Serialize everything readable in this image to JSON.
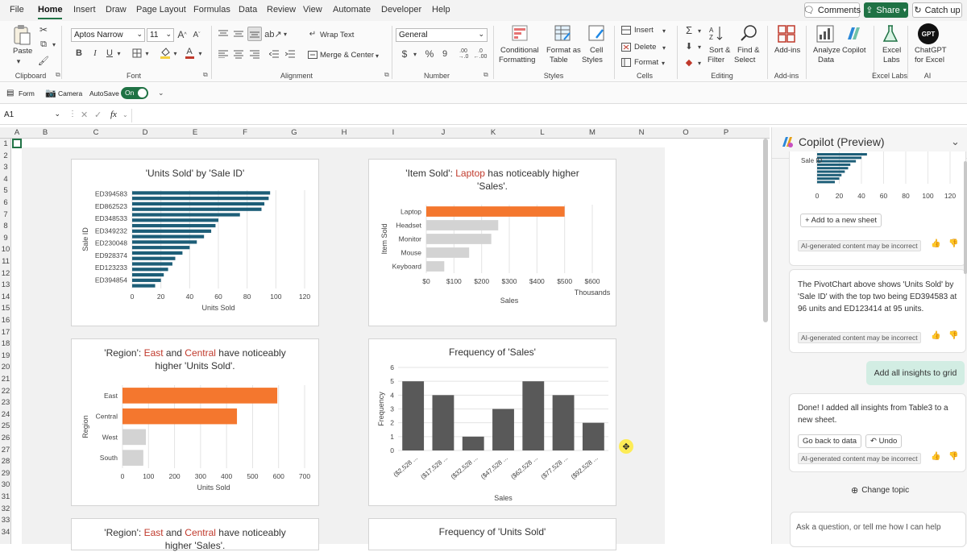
{
  "menu": {
    "items": [
      "File",
      "Home",
      "Insert",
      "Draw",
      "Page Layout",
      "Formulas",
      "Data",
      "Review",
      "View",
      "Automate",
      "Developer",
      "Help"
    ],
    "active": "Home",
    "comments_label": "Comments",
    "share_label": "Share",
    "catchup_label": "Catch up"
  },
  "ribbon": {
    "paste": "Paste",
    "font_name": "Aptos Narrow",
    "font_size": "11",
    "wrap_text": "Wrap Text",
    "merge_center": "Merge & Center",
    "number_format": "General",
    "conditional_formatting": [
      "Conditional",
      "Formatting"
    ],
    "format_as_table": [
      "Format as",
      "Table"
    ],
    "cell_styles": [
      "Cell",
      "Styles"
    ],
    "insert": "Insert",
    "delete": "Delete",
    "format": "Format",
    "sort_filter": [
      "Sort &",
      "Filter"
    ],
    "find_select": [
      "Find &",
      "Select"
    ],
    "addins": "Add-ins",
    "analyze_data": [
      "Analyze",
      "Data"
    ],
    "copilot": "Copilot",
    "excel_labs": [
      "Excel",
      "Labs"
    ],
    "chatgpt": [
      "ChatGPT",
      "for Excel"
    ],
    "gpt_badge": "GPT",
    "bold": "B",
    "italic": "I",
    "underline": "U",
    "font_color_letter": "A",
    "grow_font": "A",
    "shrink_font": "A",
    "currency": "$",
    "percent": "%",
    "comma": "9",
    "dec_inc": ".00",
    "dec_dec": ".0",
    "groups": [
      "Clipboard",
      "Font",
      "Alignment",
      "Number",
      "Styles",
      "Cells",
      "Editing",
      "Add-ins",
      "Excel Labs",
      "AI"
    ]
  },
  "toolbar2": {
    "form": "Form",
    "camera": "Camera",
    "autosave": "AutoSave",
    "autosave_state": "On"
  },
  "formula": {
    "namebox": "A1",
    "fx": "fx",
    "value": ""
  },
  "grid": {
    "columns": [
      "A",
      "B",
      "C",
      "D",
      "E",
      "F",
      "G",
      "H",
      "I",
      "J",
      "K",
      "L",
      "M",
      "N",
      "O",
      "P"
    ],
    "rows": [
      "1",
      "2",
      "3",
      "4",
      "5",
      "6",
      "7",
      "8",
      "9",
      "10",
      "11",
      "12",
      "13",
      "14",
      "15",
      "16",
      "17",
      "18",
      "19",
      "20",
      "21",
      "22",
      "23",
      "24",
      "25",
      "26",
      "27",
      "28",
      "29",
      "30",
      "31",
      "32",
      "33",
      "34"
    ]
  },
  "cards": {
    "c1_title": "'Units Sold' by 'Sale ID'",
    "c2_title_a": "'Item Sold': ",
    "c2_title_hl": "Laptop",
    "c2_title_b": " has noticeably higher",
    "c2_title_c": "'Sales'.",
    "c3_title_a": "'Region': ",
    "c3_title_hl1": "East",
    "c3_title_mid": " and ",
    "c3_title_hl2": "Central",
    "c3_title_b": " have noticeably",
    "c3_title_c": "higher 'Units Sold'.",
    "c4_title": "Frequency of 'Sales'",
    "c5_title_a": "'Region': ",
    "c5_title_hl1": "East",
    "c5_title_mid": " and ",
    "c5_title_hl2": "Central",
    "c5_title_b": " have noticeably",
    "c5_title_c": "higher 'Sales'.",
    "c6_title": "Frequency of 'Units Sold'"
  },
  "chart_data": [
    {
      "type": "bar",
      "orientation": "horizontal",
      "title": "'Units Sold' by 'Sale ID'",
      "ylabel": "Sale ID",
      "xlabel": "Units Sold",
      "category_labels_shown": [
        "ED394583",
        "ED862523",
        "ED348533",
        "ED349232",
        "ED230048",
        "ED928374",
        "ED123233",
        "ED394854"
      ],
      "values": [
        96,
        95,
        92,
        90,
        75,
        60,
        58,
        55,
        50,
        45,
        40,
        35,
        30,
        28,
        25,
        22,
        20,
        16
      ],
      "xlim": [
        0,
        120
      ],
      "xticks": [
        "0",
        "20",
        "40",
        "60",
        "80",
        "100",
        "120"
      ],
      "color": "#1d5e78"
    },
    {
      "type": "bar",
      "orientation": "horizontal",
      "title": "'Item Sold': Laptop has noticeably higher 'Sales'.",
      "ylabel": "Item Sold",
      "xlabel": "Sales",
      "xunit": "Thousands",
      "categories": [
        "Laptop",
        "Headset",
        "Monitor",
        "Mouse",
        "Keyboard"
      ],
      "values": [
        500,
        260,
        235,
        155,
        65
      ],
      "xlim": [
        0,
        600
      ],
      "xticks": [
        "$0",
        "$100",
        "$200",
        "$300",
        "$400",
        "$500",
        "$600"
      ],
      "highlight": "Laptop",
      "highlight_color": "#f4772e",
      "color": "#d3d3d3"
    },
    {
      "type": "bar",
      "orientation": "horizontal",
      "title": "'Region': East and Central have noticeably higher 'Units Sold'.",
      "ylabel": "Region",
      "xlabel": "Units Sold",
      "categories": [
        "East",
        "Central",
        "West",
        "South"
      ],
      "values": [
        595,
        440,
        90,
        80
      ],
      "xlim": [
        0,
        700
      ],
      "xticks": [
        "0",
        "100",
        "200",
        "300",
        "400",
        "500",
        "600",
        "700"
      ],
      "highlight": [
        "East",
        "Central"
      ],
      "highlight_color": "#f4772e",
      "color": "#d3d3d3"
    },
    {
      "type": "bar",
      "title": "Frequency of 'Sales'",
      "ylabel": "Frequency",
      "xlabel": "Sales",
      "categories": [
        "($2,528 ...",
        "($17,528 ...",
        "($32,528 ...",
        "($47,528 ...",
        "($62,528 ...",
        "($77,528 ...",
        "($92,528 ..."
      ],
      "values": [
        5,
        4,
        1,
        3,
        5,
        4,
        2
      ],
      "ylim": [
        0,
        6
      ],
      "yticks": [
        "0",
        "1",
        "2",
        "3",
        "4",
        "5",
        "6"
      ],
      "color": "#595959"
    }
  ],
  "copilot": {
    "header": "Copilot (Preview)",
    "mini_xticks": [
      "0",
      "20",
      "40",
      "60",
      "80",
      "100",
      "120"
    ],
    "add_sheet": "Add to a new sheet",
    "disclaimer": "AI-generated content may be incorrect",
    "msg2": "The PivotChart above shows 'Units Sold' by 'Sale ID' with the top two being ED394583 at 96 units and ED123414 at 95 units.",
    "user_msg": "Add all insights to grid",
    "msg3": "Done! I added all insights from Table3 to a new sheet.",
    "go_back": "Go back to data",
    "undo": "Undo",
    "change_topic": "Change topic",
    "input_placeholder": "Ask a question, or tell me how I can help"
  }
}
